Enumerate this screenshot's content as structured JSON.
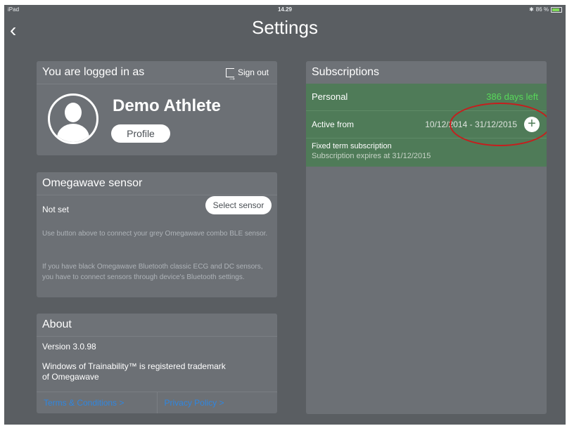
{
  "status_bar": {
    "device": "iPad",
    "time": "14.29",
    "battery": "86 %"
  },
  "nav": {
    "back_icon": "chevron-left-icon",
    "title": "Settings"
  },
  "login": {
    "header": "You are logged in as",
    "signout": "Sign out",
    "name": "Demo Athlete",
    "profile_button": "Profile"
  },
  "sensor": {
    "header": "Omegawave sensor",
    "status": "Not set",
    "select_button": "Select sensor",
    "help1": "Use button above to connect your grey Omegawave combo BLE sensor.",
    "help2": "If you have black Omegawave Bluetooth classic ECG and DC sensors, you have to connect sensors through device's Bluetooth settings."
  },
  "about": {
    "header": "About",
    "version": "Version 3.0.98",
    "trademark": "Windows of Trainability™ is registered trademark of Omegawave",
    "terms": "Terms & Conditions >",
    "privacy": "Privacy Policy >"
  },
  "subscriptions": {
    "header": "Subscriptions",
    "type": "Personal",
    "days_left": "386 days left",
    "active_label": "Active from",
    "active_dates": "10/12/2014 - 31/12/2015",
    "fixed_term": "Fixed term subscription",
    "expires": "Subscription expires at 31/12/2015"
  },
  "colors": {
    "background": "#5a5e62",
    "panel": "#6c7075",
    "green_row": "#4f7b58",
    "days_left": "#58d85a",
    "link": "#2f86e0",
    "highlight": "#c71d1d"
  }
}
